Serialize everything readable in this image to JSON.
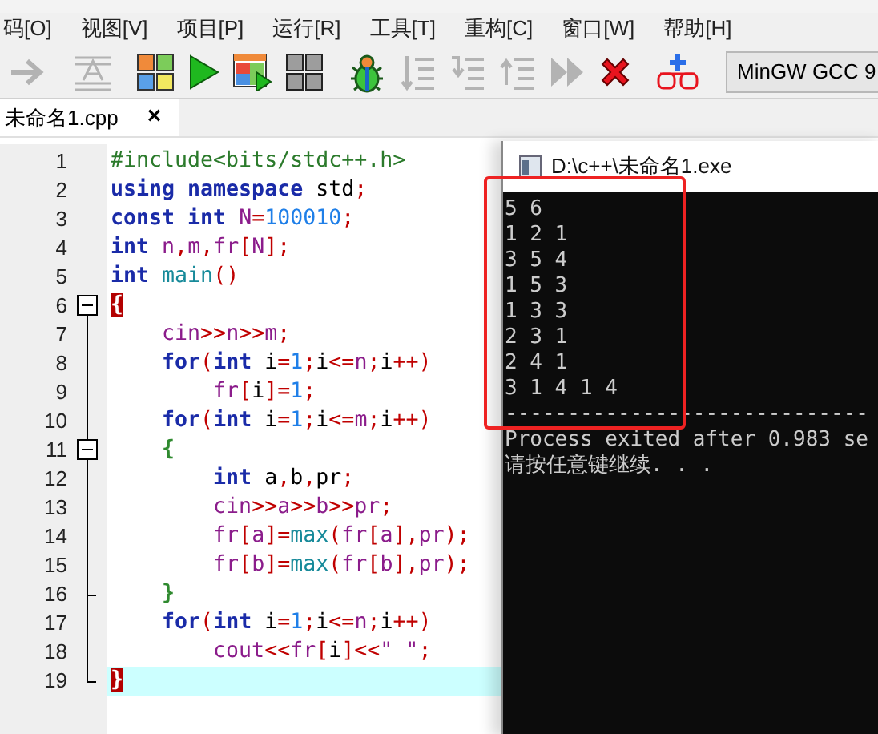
{
  "menu": [
    {
      "label": "码[O]"
    },
    {
      "label": "视图[V]"
    },
    {
      "label": "项目[P]"
    },
    {
      "label": "运行[R]"
    },
    {
      "label": "工具[T]"
    },
    {
      "label": "重构[C]"
    },
    {
      "label": "窗口[W]"
    },
    {
      "label": "帮助[H]"
    }
  ],
  "toolbar": [
    {
      "kind": "forward",
      "disabled": true
    },
    {
      "kind": "separator"
    },
    {
      "kind": "format",
      "disabled": true
    },
    {
      "kind": "separator"
    },
    {
      "kind": "compile",
      "disabled": false
    },
    {
      "kind": "run",
      "disabled": false
    },
    {
      "kind": "compile-run",
      "disabled": false
    },
    {
      "kind": "rebuild",
      "disabled": false
    },
    {
      "kind": "separator"
    },
    {
      "kind": "debug",
      "disabled": false
    },
    {
      "kind": "step-over",
      "disabled": true
    },
    {
      "kind": "step-into",
      "disabled": true
    },
    {
      "kind": "step-out",
      "disabled": true
    },
    {
      "kind": "continue",
      "disabled": true
    },
    {
      "kind": "stop",
      "disabled": false
    },
    {
      "kind": "separator"
    },
    {
      "kind": "profile",
      "disabled": false
    },
    {
      "kind": "separator"
    }
  ],
  "compiler": {
    "value": "MinGW GCC 9"
  },
  "tabs": [
    {
      "label": "未命名1.cpp",
      "selected": true,
      "close": "×"
    }
  ],
  "editor": {
    "lines": [
      {
        "number": "1",
        "current": false,
        "fold_end": false,
        "tokens": [
          {
            "kind": "preproc",
            "text": "#include<bits/stdc++.h>"
          }
        ]
      },
      {
        "number": "2",
        "current": false,
        "fold_end": false,
        "tokens": [
          {
            "kind": "keyword",
            "text": "using namespace"
          },
          {
            "kind": "plain",
            "text": " std"
          },
          {
            "kind": "op",
            "text": ";"
          }
        ]
      },
      {
        "number": "3",
        "current": false,
        "fold_end": false,
        "tokens": [
          {
            "kind": "keyword",
            "text": "const int"
          },
          {
            "kind": "ident",
            "text": " N"
          },
          {
            "kind": "op",
            "text": "="
          },
          {
            "kind": "number",
            "text": "100010"
          },
          {
            "kind": "op",
            "text": ";"
          }
        ]
      },
      {
        "number": "4",
        "current": false,
        "fold_end": false,
        "tokens": [
          {
            "kind": "keyword",
            "text": "int"
          },
          {
            "kind": "ident",
            "text": " n"
          },
          {
            "kind": "op",
            "text": ","
          },
          {
            "kind": "ident",
            "text": "m"
          },
          {
            "kind": "op",
            "text": ","
          },
          {
            "kind": "ident",
            "text": "fr"
          },
          {
            "kind": "op",
            "text": "["
          },
          {
            "kind": "ident",
            "text": "N"
          },
          {
            "kind": "op",
            "text": "];"
          }
        ]
      },
      {
        "number": "5",
        "current": false,
        "fold_end": false,
        "tokens": [
          {
            "kind": "keyword",
            "text": "int"
          },
          {
            "kind": "func",
            "text": " main"
          },
          {
            "kind": "op",
            "text": "()"
          }
        ]
      },
      {
        "number": "6",
        "current": false,
        "fold": {
          "expanded": true
        },
        "fold_end": false,
        "tokens": [
          {
            "kind": "brace-match",
            "text": "{"
          }
        ]
      },
      {
        "number": "7",
        "current": false,
        "fold_end": false,
        "tokens": [
          {
            "kind": "ident",
            "text": "    cin"
          },
          {
            "kind": "op",
            "text": ">>"
          },
          {
            "kind": "ident",
            "text": "n"
          },
          {
            "kind": "op",
            "text": ">>"
          },
          {
            "kind": "ident",
            "text": "m"
          },
          {
            "kind": "op",
            "text": ";"
          }
        ]
      },
      {
        "number": "8",
        "current": false,
        "fold_end": false,
        "tokens": [
          {
            "kind": "keyword",
            "text": "    for"
          },
          {
            "kind": "op",
            "text": "("
          },
          {
            "kind": "keyword",
            "text": "int"
          },
          {
            "kind": "plain",
            "text": " i"
          },
          {
            "kind": "op",
            "text": "="
          },
          {
            "kind": "number",
            "text": "1"
          },
          {
            "kind": "op",
            "text": ";"
          },
          {
            "kind": "plain",
            "text": "i"
          },
          {
            "kind": "op",
            "text": "<="
          },
          {
            "kind": "ident",
            "text": "n"
          },
          {
            "kind": "op",
            "text": ";"
          },
          {
            "kind": "plain",
            "text": "i"
          },
          {
            "kind": "op",
            "text": "++)"
          }
        ]
      },
      {
        "number": "9",
        "current": false,
        "fold_end": false,
        "tokens": [
          {
            "kind": "ident",
            "text": "        fr"
          },
          {
            "kind": "op",
            "text": "["
          },
          {
            "kind": "plain",
            "text": "i"
          },
          {
            "kind": "op",
            "text": "]="
          },
          {
            "kind": "number",
            "text": "1"
          },
          {
            "kind": "op",
            "text": ";"
          }
        ]
      },
      {
        "number": "10",
        "current": false,
        "fold_end": false,
        "tokens": [
          {
            "kind": "keyword",
            "text": "    for"
          },
          {
            "kind": "op",
            "text": "("
          },
          {
            "kind": "keyword",
            "text": "int"
          },
          {
            "kind": "plain",
            "text": " i"
          },
          {
            "kind": "op",
            "text": "="
          },
          {
            "kind": "number",
            "text": "1"
          },
          {
            "kind": "op",
            "text": ";"
          },
          {
            "kind": "plain",
            "text": "i"
          },
          {
            "kind": "op",
            "text": "<="
          },
          {
            "kind": "ident",
            "text": "m"
          },
          {
            "kind": "op",
            "text": ";"
          },
          {
            "kind": "plain",
            "text": "i"
          },
          {
            "kind": "op",
            "text": "++)"
          }
        ]
      },
      {
        "number": "11",
        "current": false,
        "fold": {
          "expanded": true
        },
        "fold_end": false,
        "tokens": [
          {
            "kind": "brace",
            "text": "    {"
          }
        ]
      },
      {
        "number": "12",
        "current": false,
        "fold_end": false,
        "tokens": [
          {
            "kind": "keyword",
            "text": "        int"
          },
          {
            "kind": "plain",
            "text": " a"
          },
          {
            "kind": "op",
            "text": ","
          },
          {
            "kind": "plain",
            "text": "b"
          },
          {
            "kind": "op",
            "text": ","
          },
          {
            "kind": "plain",
            "text": "pr"
          },
          {
            "kind": "op",
            "text": ";"
          }
        ]
      },
      {
        "number": "13",
        "current": false,
        "fold_end": false,
        "tokens": [
          {
            "kind": "ident",
            "text": "        cin"
          },
          {
            "kind": "op",
            "text": ">>"
          },
          {
            "kind": "ident",
            "text": "a"
          },
          {
            "kind": "op",
            "text": ">>"
          },
          {
            "kind": "ident",
            "text": "b"
          },
          {
            "kind": "op",
            "text": ">>"
          },
          {
            "kind": "ident",
            "text": "pr"
          },
          {
            "kind": "op",
            "text": ";"
          }
        ]
      },
      {
        "number": "14",
        "current": false,
        "fold_end": false,
        "tokens": [
          {
            "kind": "ident",
            "text": "        fr"
          },
          {
            "kind": "op",
            "text": "["
          },
          {
            "kind": "ident",
            "text": "a"
          },
          {
            "kind": "op",
            "text": "]="
          },
          {
            "kind": "func",
            "text": "max"
          },
          {
            "kind": "op",
            "text": "("
          },
          {
            "kind": "ident",
            "text": "fr"
          },
          {
            "kind": "op",
            "text": "["
          },
          {
            "kind": "ident",
            "text": "a"
          },
          {
            "kind": "op",
            "text": "],"
          },
          {
            "kind": "ident",
            "text": "pr"
          },
          {
            "kind": "op",
            "text": ");"
          }
        ]
      },
      {
        "number": "15",
        "current": false,
        "fold_end": false,
        "tokens": [
          {
            "kind": "ident",
            "text": "        fr"
          },
          {
            "kind": "op",
            "text": "["
          },
          {
            "kind": "ident",
            "text": "b"
          },
          {
            "kind": "op",
            "text": "]="
          },
          {
            "kind": "func",
            "text": "max"
          },
          {
            "kind": "op",
            "text": "("
          },
          {
            "kind": "ident",
            "text": "fr"
          },
          {
            "kind": "op",
            "text": "["
          },
          {
            "kind": "ident",
            "text": "b"
          },
          {
            "kind": "op",
            "text": "],"
          },
          {
            "kind": "ident",
            "text": "pr"
          },
          {
            "kind": "op",
            "text": ");"
          }
        ]
      },
      {
        "number": "16",
        "current": false,
        "fold_end": true,
        "tokens": [
          {
            "kind": "brace",
            "text": "    }"
          }
        ]
      },
      {
        "number": "17",
        "current": false,
        "fold_end": false,
        "tokens": [
          {
            "kind": "keyword",
            "text": "    for"
          },
          {
            "kind": "op",
            "text": "("
          },
          {
            "kind": "keyword",
            "text": "int"
          },
          {
            "kind": "plain",
            "text": " i"
          },
          {
            "kind": "op",
            "text": "="
          },
          {
            "kind": "number",
            "text": "1"
          },
          {
            "kind": "op",
            "text": ";"
          },
          {
            "kind": "plain",
            "text": "i"
          },
          {
            "kind": "op",
            "text": "<="
          },
          {
            "kind": "ident",
            "text": "n"
          },
          {
            "kind": "op",
            "text": ";"
          },
          {
            "kind": "plain",
            "text": "i"
          },
          {
            "kind": "op",
            "text": "++)"
          }
        ]
      },
      {
        "number": "18",
        "current": false,
        "fold_end": false,
        "tokens": [
          {
            "kind": "ident",
            "text": "        cout"
          },
          {
            "kind": "op",
            "text": "<<"
          },
          {
            "kind": "ident",
            "text": "fr"
          },
          {
            "kind": "op",
            "text": "["
          },
          {
            "kind": "plain",
            "text": "i"
          },
          {
            "kind": "op",
            "text": "]<<"
          },
          {
            "kind": "string",
            "text": "\" \""
          },
          {
            "kind": "op",
            "text": ";"
          }
        ]
      },
      {
        "number": "19",
        "current": true,
        "fold_end": true,
        "tokens": [
          {
            "kind": "brace-match",
            "text": "}"
          }
        ]
      }
    ]
  },
  "console": {
    "title": "D:\\c++\\未命名1.exe",
    "lines": [
      "5 6",
      "1 2 1",
      "3 5 4",
      "1 5 3",
      "1 3 3",
      "2 3 1",
      "2 4 1",
      "3 1 4 1 4",
      "-----------------------------",
      "Process exited after 0.983 se",
      "请按任意键继续. . ."
    ]
  }
}
